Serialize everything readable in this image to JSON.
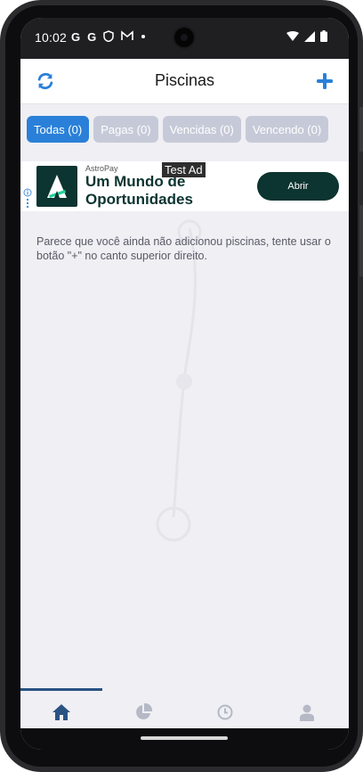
{
  "status_bar": {
    "time": "10:02",
    "notification_icons": [
      "G",
      "G"
    ]
  },
  "header": {
    "title": "Piscinas",
    "refresh_icon": "refresh-icon",
    "add_icon": "plus-icon"
  },
  "filters": [
    {
      "label": "Todas (0)",
      "active": true
    },
    {
      "label": "Pagas (0)",
      "active": false
    },
    {
      "label": "Vencidas (0)",
      "active": false
    },
    {
      "label": "Vencendo (0)",
      "active": false
    }
  ],
  "ad": {
    "brand": "AstroPay",
    "headline": "Um Mundo de Oportunidades",
    "test_label": "Test Ad",
    "cta": "Abrir"
  },
  "empty_message": "Parece que você ainda não adicionou piscinas, tente usar o botão \"+\" no canto superior direito.",
  "bottom_nav": {
    "tabs": [
      {
        "icon": "home-icon",
        "active": true
      },
      {
        "icon": "pie-chart-icon",
        "active": false
      },
      {
        "icon": "clock-icon",
        "active": false
      },
      {
        "icon": "user-icon",
        "active": false
      }
    ]
  },
  "colors": {
    "accent": "#2a80d8",
    "chip_inactive": "#c6cad8",
    "nav_active": "#2a5283",
    "nav_inactive": "#b5b9c6",
    "ad_brand": "#0c3430"
  }
}
